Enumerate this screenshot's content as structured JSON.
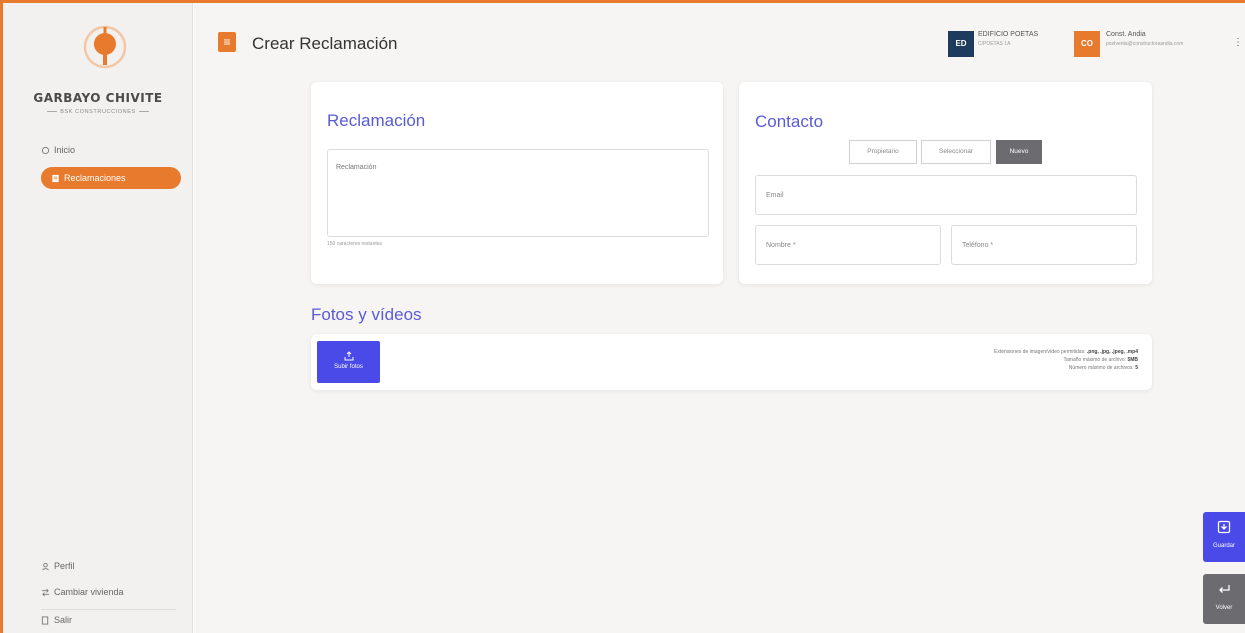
{
  "brand": {
    "name": "GARBAYO CHIVITE",
    "tagline": "BSK CONSTRUCCIONES"
  },
  "sidebar": {
    "items": [
      {
        "label": "Inicio",
        "icon": "home-icon"
      },
      {
        "label": "Reclamaciones",
        "icon": "document-icon"
      }
    ],
    "bottom": [
      {
        "label": "Perfil",
        "icon": "user-icon"
      },
      {
        "label": "Cambiar vivienda",
        "icon": "swap-icon"
      },
      {
        "label": "Salir",
        "icon": "logout-icon"
      }
    ]
  },
  "header": {
    "menu_icon": "≡",
    "title": "Crear Reclamación",
    "building": {
      "initials": "ED",
      "name": "EDIFICIO POETAS",
      "sub": "C/POETAS 1A"
    },
    "user": {
      "initials": "CO",
      "name": "Const. Andia",
      "sub": "postventa@constructoraandia.com"
    },
    "more": "⋮"
  },
  "reclamacion": {
    "title": "Reclamación",
    "placeholder": "Reclamación",
    "hint": "150 caracteres restantes"
  },
  "contacto": {
    "title": "Contacto",
    "options": [
      "Propietario",
      "Seleccionar",
      "Nuevo"
    ],
    "active_option": "Nuevo",
    "email_placeholder": "Email",
    "nombre_placeholder": "Nombre *",
    "telefono_placeholder": "Teléfono *"
  },
  "fotos": {
    "title": "Fotos y vídeos",
    "upload_label": "Subir fotos",
    "info_line1_prefix": "Extensiones de imagen/vídeo permitidas:",
    "info_line1_value": ".png, .jpg, .jpeg, .mp4",
    "info_line2_prefix": "Tamaño máximo de archivo:",
    "info_line2_value": "5MB",
    "info_line3_prefix": "Número máximo de archivos:",
    "info_line3_value": "5"
  },
  "actions": {
    "save_label": "Guardar",
    "back_label": "Volver"
  },
  "colors": {
    "accent": "#e87a2d",
    "primary": "#4a4ae8",
    "title": "#5a5ad8",
    "building_badge": "#1e3a5c"
  }
}
